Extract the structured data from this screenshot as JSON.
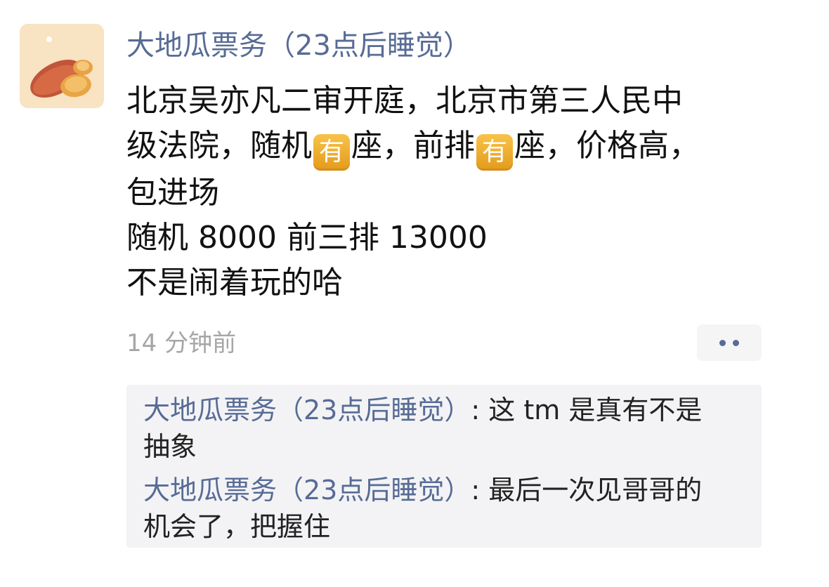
{
  "post": {
    "author": "大地瓜票务（23点后睡觉）",
    "content": {
      "line1": "北京吴亦凡二审开庭，北京市第三人民中",
      "line2_a": "级法院，随机",
      "emoji_char": "有",
      "line2_b": "座，前排",
      "line2_c": "座，价格高，",
      "line3": "包进场",
      "line4": "随机 8000 前三排 13000",
      "line5": "不是闹着玩的哈"
    },
    "time": "14 分钟前",
    "more_icon": "ellipsis-icon",
    "colors": {
      "author": "#576b95",
      "emoji_badge": "#f0aa2a",
      "comment_background": "#f3f3f5",
      "timestamp": "#a6a6a6"
    }
  },
  "comments": [
    {
      "author": "大地瓜票务（23点后睡觉）",
      "separator": ": ",
      "text_part1": "这 tm 是真有不是",
      "text_part2": "抽象"
    },
    {
      "author": "大地瓜票务（23点后睡觉）",
      "separator": ": ",
      "text_part1": "最后一次见哥哥的",
      "text_part2": "机会了，把握住"
    }
  ]
}
